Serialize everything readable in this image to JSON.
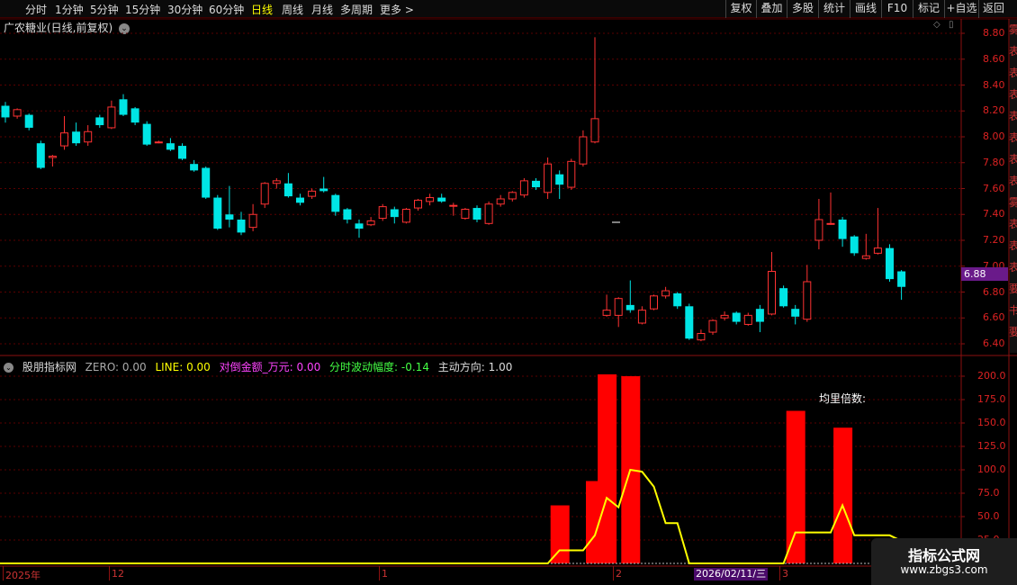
{
  "toolbar": {
    "timeframes": [
      "分时",
      "1分钟",
      "5分钟",
      "15分钟",
      "30分钟",
      "60分钟",
      "日线",
      "周线",
      "月线",
      "多周期",
      "更多 >"
    ],
    "active_timeframe": "日线",
    "right_buttons": [
      "复权",
      "叠加",
      "多股",
      "统计",
      "画线",
      "F10",
      "标记",
      "+自选",
      "返回"
    ]
  },
  "chart_title": "广农糖业(日线,前复权)",
  "price_axis": [
    "8.80",
    "8.60",
    "8.40",
    "8.20",
    "8.00",
    "7.80",
    "7.60",
    "7.40",
    "7.20",
    "7.00",
    "6.80",
    "6.60",
    "6.40"
  ],
  "current_price": "6.88",
  "indicator": {
    "name": "股朋指标网",
    "zero": "ZERO: 0.00",
    "line": "LINE: 0.00",
    "amount": "对倒金额_万元: 0.00",
    "fluct": "分时波动幅度: -0.14",
    "direction": "主动方向: 1.00",
    "annotation": "均里倍数:",
    "axis": [
      "200.0",
      "175.0",
      "150.0",
      "125.0",
      "100.0",
      "75.0",
      "50.0",
      "25.0"
    ]
  },
  "x_axis": {
    "labels": [
      "2025年",
      "12",
      "1",
      "2",
      "3"
    ],
    "selected_date": "2026/02/11/三"
  },
  "side_text": [
    "雾",
    "表",
    "表",
    "表",
    "表",
    "表",
    "表",
    "表",
    "雾",
    "表",
    "表",
    "表",
    "要",
    "书",
    "要"
  ],
  "watermark": {
    "title": "指标公式网",
    "url": "www.zbgs3.com"
  },
  "colors": {
    "up": "#ff3232",
    "down": "#00e5e5",
    "bars": "#ff0000",
    "line": "#ffff00"
  },
  "chart_data": {
    "type": "candlestick",
    "candles": [
      {
        "o": 8.24,
        "c": 8.15,
        "h": 8.27,
        "l": 8.11
      },
      {
        "o": 8.16,
        "c": 8.21,
        "h": 8.22,
        "l": 8.14
      },
      {
        "o": 8.17,
        "c": 8.07,
        "h": 8.18,
        "l": 8.05
      },
      {
        "o": 7.95,
        "c": 7.76,
        "h": 7.97,
        "l": 7.75
      },
      {
        "o": 7.84,
        "c": 7.85,
        "h": 7.86,
        "l": 7.77
      },
      {
        "o": 7.93,
        "c": 8.03,
        "h": 8.16,
        "l": 7.9
      },
      {
        "o": 8.04,
        "c": 7.95,
        "h": 8.11,
        "l": 7.93
      },
      {
        "o": 7.96,
        "c": 8.04,
        "h": 8.09,
        "l": 7.93
      },
      {
        "o": 8.15,
        "c": 8.09,
        "h": 8.17,
        "l": 8.07
      },
      {
        "o": 8.07,
        "c": 8.23,
        "h": 8.28,
        "l": 8.06
      },
      {
        "o": 8.29,
        "c": 8.17,
        "h": 8.33,
        "l": 8.16
      },
      {
        "o": 8.22,
        "c": 8.11,
        "h": 8.23,
        "l": 8.09
      },
      {
        "o": 8.1,
        "c": 7.94,
        "h": 8.12,
        "l": 7.93
      },
      {
        "o": 7.96,
        "c": 7.96,
        "h": 7.97,
        "l": 7.95
      },
      {
        "o": 7.95,
        "c": 7.9,
        "h": 7.99,
        "l": 7.89
      },
      {
        "o": 7.93,
        "c": 7.83,
        "h": 7.95,
        "l": 7.82
      },
      {
        "o": 7.79,
        "c": 7.74,
        "h": 7.82,
        "l": 7.73
      },
      {
        "o": 7.76,
        "c": 7.53,
        "h": 7.77,
        "l": 7.52
      },
      {
        "o": 7.53,
        "c": 7.29,
        "h": 7.55,
        "l": 7.28
      },
      {
        "o": 7.4,
        "c": 7.36,
        "h": 7.62,
        "l": 7.3
      },
      {
        "o": 7.36,
        "c": 7.26,
        "h": 7.42,
        "l": 7.24
      },
      {
        "o": 7.3,
        "c": 7.4,
        "h": 7.48,
        "l": 7.27
      },
      {
        "o": 7.48,
        "c": 7.64,
        "h": 7.65,
        "l": 7.45
      },
      {
        "o": 7.64,
        "c": 7.66,
        "h": 7.68,
        "l": 7.6
      },
      {
        "o": 7.64,
        "c": 7.54,
        "h": 7.72,
        "l": 7.53
      },
      {
        "o": 7.53,
        "c": 7.49,
        "h": 7.56,
        "l": 7.47
      },
      {
        "o": 7.54,
        "c": 7.58,
        "h": 7.6,
        "l": 7.52
      },
      {
        "o": 7.6,
        "c": 7.58,
        "h": 7.69,
        "l": 7.57
      },
      {
        "o": 7.55,
        "c": 7.42,
        "h": 7.56,
        "l": 7.39
      },
      {
        "o": 7.44,
        "c": 7.36,
        "h": 7.45,
        "l": 7.33
      },
      {
        "o": 7.33,
        "c": 7.29,
        "h": 7.36,
        "l": 7.22
      },
      {
        "o": 7.32,
        "c": 7.35,
        "h": 7.38,
        "l": 7.31
      },
      {
        "o": 7.37,
        "c": 7.46,
        "h": 7.48,
        "l": 7.35
      },
      {
        "o": 7.44,
        "c": 7.38,
        "h": 7.46,
        "l": 7.33
      },
      {
        "o": 7.34,
        "c": 7.44,
        "h": 7.45,
        "l": 7.33
      },
      {
        "o": 7.45,
        "c": 7.51,
        "h": 7.52,
        "l": 7.43
      },
      {
        "o": 7.5,
        "c": 7.53,
        "h": 7.56,
        "l": 7.47
      },
      {
        "o": 7.53,
        "c": 7.5,
        "h": 7.56,
        "l": 7.49
      },
      {
        "o": 7.47,
        "c": 7.47,
        "h": 7.49,
        "l": 7.39
      },
      {
        "o": 7.37,
        "c": 7.44,
        "h": 7.45,
        "l": 7.36
      },
      {
        "o": 7.45,
        "c": 7.36,
        "h": 7.47,
        "l": 7.34
      },
      {
        "o": 7.33,
        "c": 7.48,
        "h": 7.5,
        "l": 7.32
      },
      {
        "o": 7.48,
        "c": 7.52,
        "h": 7.55,
        "l": 7.46
      },
      {
        "o": 7.52,
        "c": 7.57,
        "h": 7.58,
        "l": 7.5
      },
      {
        "o": 7.55,
        "c": 7.66,
        "h": 7.68,
        "l": 7.53
      },
      {
        "o": 7.66,
        "c": 7.61,
        "h": 7.68,
        "l": 7.59
      },
      {
        "o": 7.57,
        "c": 7.79,
        "h": 7.84,
        "l": 7.52
      },
      {
        "o": 7.71,
        "c": 7.63,
        "h": 7.74,
        "l": 7.52
      },
      {
        "o": 7.61,
        "c": 7.81,
        "h": 7.83,
        "l": 7.59
      },
      {
        "o": 7.79,
        "c": 8.0,
        "h": 8.05,
        "l": 7.77
      },
      {
        "o": 7.96,
        "c": 8.14,
        "h": 8.77,
        "l": 7.95
      },
      {
        "o": 6.62,
        "c": 6.66,
        "h": 6.78,
        "l": 6.61
      },
      {
        "o": 6.62,
        "c": 6.75,
        "h": 6.76,
        "l": 6.53
      },
      {
        "o": 6.7,
        "c": 6.66,
        "h": 6.89,
        "l": 6.64
      },
      {
        "o": 6.56,
        "c": 6.66,
        "h": 6.69,
        "l": 6.55
      },
      {
        "o": 6.67,
        "c": 6.77,
        "h": 6.78,
        "l": 6.66
      },
      {
        "o": 6.77,
        "c": 6.81,
        "h": 6.84,
        "l": 6.75
      },
      {
        "o": 6.79,
        "c": 6.69,
        "h": 6.8,
        "l": 6.67
      },
      {
        "o": 6.69,
        "c": 6.44,
        "h": 6.71,
        "l": 6.43
      },
      {
        "o": 6.43,
        "c": 6.48,
        "h": 6.51,
        "l": 6.42
      },
      {
        "o": 6.49,
        "c": 6.58,
        "h": 6.59,
        "l": 6.47
      },
      {
        "o": 6.6,
        "c": 6.62,
        "h": 6.65,
        "l": 6.58
      },
      {
        "o": 6.64,
        "c": 6.57,
        "h": 6.65,
        "l": 6.55
      },
      {
        "o": 6.55,
        "c": 6.62,
        "h": 6.64,
        "l": 6.54
      },
      {
        "o": 6.67,
        "c": 6.57,
        "h": 6.7,
        "l": 6.49
      },
      {
        "o": 6.63,
        "c": 6.96,
        "h": 7.11,
        "l": 6.62
      },
      {
        "o": 6.83,
        "c": 6.69,
        "h": 6.85,
        "l": 6.68
      },
      {
        "o": 6.67,
        "c": 6.61,
        "h": 6.7,
        "l": 6.55
      },
      {
        "o": 6.59,
        "c": 6.88,
        "h": 7.01,
        "l": 6.57
      },
      {
        "o": 7.2,
        "c": 7.36,
        "h": 7.52,
        "l": 7.13
      },
      {
        "o": 7.33,
        "c": 7.33,
        "h": 7.57,
        "l": 7.32
      },
      {
        "o": 7.36,
        "c": 7.21,
        "h": 7.38,
        "l": 7.15
      },
      {
        "o": 7.23,
        "c": 7.1,
        "h": 7.24,
        "l": 7.08
      },
      {
        "o": 7.06,
        "c": 7.08,
        "h": 7.25,
        "l": 7.05
      },
      {
        "o": 7.1,
        "c": 7.14,
        "h": 7.45,
        "l": 7.09
      },
      {
        "o": 7.14,
        "c": 6.9,
        "h": 7.17,
        "l": 6.88
      },
      {
        "o": 6.96,
        "c": 6.84,
        "h": 6.97,
        "l": 6.74
      }
    ],
    "indicator_bars": [
      {
        "index": 47,
        "value": 62
      },
      {
        "index": 50,
        "value": 88
      },
      {
        "index": 51,
        "value": 202
      },
      {
        "index": 53,
        "value": 200
      },
      {
        "index": 67,
        "value": 163
      },
      {
        "index": 71,
        "value": 145
      }
    ],
    "indicator_line": [
      [
        0,
        0
      ],
      [
        46,
        0
      ],
      [
        47,
        14
      ],
      [
        49,
        14
      ],
      [
        50,
        30
      ],
      [
        51,
        70
      ],
      [
        52,
        60
      ],
      [
        53,
        100
      ],
      [
        54,
        98
      ],
      [
        55,
        82
      ],
      [
        56,
        43
      ],
      [
        57,
        43
      ],
      [
        58,
        0
      ],
      [
        66,
        0
      ],
      [
        67,
        33
      ],
      [
        70,
        33
      ],
      [
        71,
        62
      ],
      [
        72,
        30
      ],
      [
        75,
        30
      ],
      [
        76,
        24
      ],
      [
        77,
        24
      ]
    ],
    "price_range": [
      6.35,
      8.85
    ],
    "indicator_range": [
      0,
      210
    ]
  }
}
